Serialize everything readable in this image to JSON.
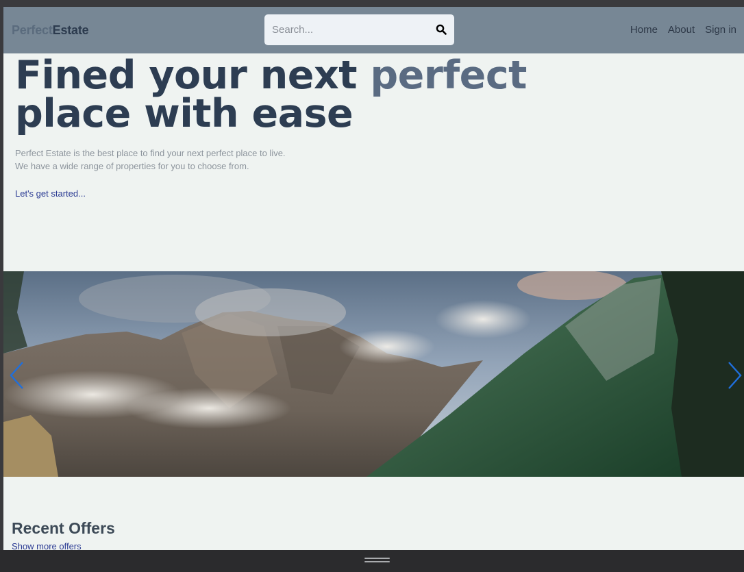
{
  "navbar": {
    "brand_part1": "Perfect",
    "brand_part2": "Estate",
    "search_placeholder": "Search...",
    "search_icon": "search-icon",
    "links": [
      "Home",
      "About",
      "Sign in"
    ]
  },
  "hero": {
    "title_part1": "Fined your next ",
    "title_accent": "perfect",
    "title_line2": "place with ease",
    "desc_line1": "Perfect Estate is the best place to find your next perfect place to live.",
    "desc_line2": "We have a wide range of properties for you to choose from.",
    "cta": "Let's get started..."
  },
  "carousel": {
    "prev_icon": "chevron-left-icon",
    "next_icon": "chevron-right-icon",
    "arrow_color": "#1f6fdc"
  },
  "recent": {
    "title": "Recent Offers",
    "link": "Show more offers"
  },
  "colors": {
    "navbar_bg": "#778795",
    "page_bg": "#eff3f1",
    "title": "#2d3d52",
    "accent": "#5a6b82",
    "link": "#2a3a93"
  }
}
